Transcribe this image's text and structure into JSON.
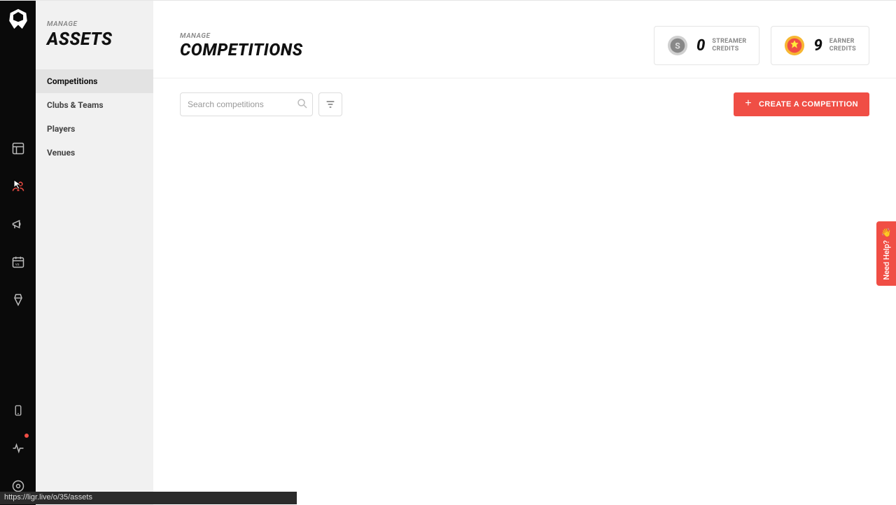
{
  "sidebar": {
    "overline": "MANAGE",
    "title": "ASSETS",
    "items": [
      {
        "label": "Competitions",
        "active": true
      },
      {
        "label": "Clubs & Teams"
      },
      {
        "label": "Players"
      },
      {
        "label": "Venues"
      }
    ]
  },
  "header": {
    "overline": "MANAGE",
    "title": "COMPETITIONS"
  },
  "credits": {
    "streamer": {
      "value": "0",
      "line1": "STREAMER",
      "line2": "CREDITS"
    },
    "earner": {
      "value": "9",
      "line1": "EARNER",
      "line2": "CREDITS"
    }
  },
  "toolbar": {
    "search_placeholder": "Search competitions",
    "create_label": "CREATE A COMPETITION"
  },
  "help_tab": "Need Help?",
  "status_url": "https://ligr.live/o/35/assets",
  "colors": {
    "accent": "#f04e45"
  }
}
